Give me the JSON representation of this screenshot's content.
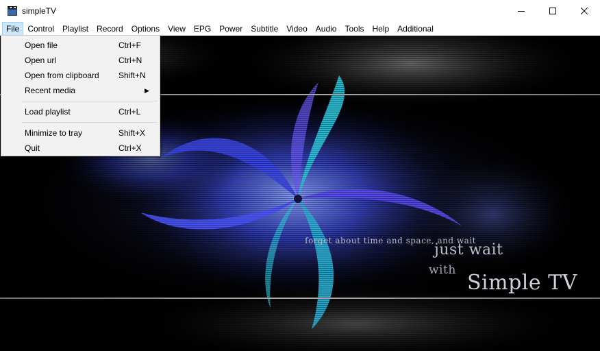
{
  "window": {
    "title": "simpleTV",
    "icon": "clapperboard-icon",
    "controls": [
      "minimize-icon",
      "maximize-icon",
      "close-icon"
    ]
  },
  "menubar": {
    "items": [
      {
        "label": "File",
        "active": true
      },
      {
        "label": "Control"
      },
      {
        "label": "Playlist"
      },
      {
        "label": "Record"
      },
      {
        "label": "Options"
      },
      {
        "label": "View"
      },
      {
        "label": "EPG"
      },
      {
        "label": "Power"
      },
      {
        "label": "Subtitle"
      },
      {
        "label": "Video"
      },
      {
        "label": "Audio"
      },
      {
        "label": "Tools"
      },
      {
        "label": "Help"
      },
      {
        "label": "Additional"
      }
    ]
  },
  "file_menu": {
    "groups": [
      [
        {
          "label": "Open file",
          "shortcut": "Ctrl+F"
        },
        {
          "label": "Open url",
          "shortcut": "Ctrl+N"
        },
        {
          "label": "Open from clipboard",
          "shortcut": "Shift+N"
        },
        {
          "label": "Recent media",
          "shortcut": "",
          "submenu": true
        }
      ],
      [
        {
          "label": "Load playlist",
          "shortcut": "Ctrl+L"
        }
      ],
      [
        {
          "label": "Minimize to tray",
          "shortcut": "Shift+X"
        },
        {
          "label": "Quit",
          "shortcut": "Ctrl+X"
        }
      ]
    ]
  },
  "video": {
    "caption_small": "forget about time and space, and wait",
    "caption_just_wait": "just wait",
    "caption_with": "with",
    "caption_brand": "Simple TV"
  },
  "colors": {
    "menu_active_bg": "#cce8ff",
    "menu_active_border": "#99d1ff",
    "dropdown_bg": "#f2f2f2",
    "video_bg": "#000000",
    "swirl_blue": "#4a5cff",
    "swirl_cyan": "#2ad0e0"
  }
}
